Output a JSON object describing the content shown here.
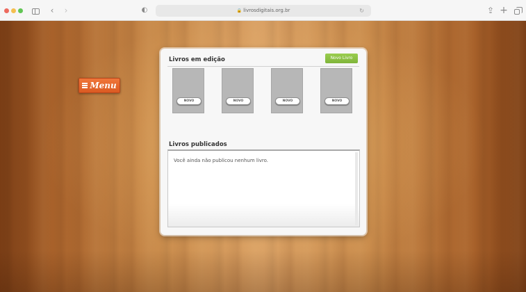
{
  "browser": {
    "url": "livrosdigitais.org.br"
  },
  "menu": {
    "label": "Menu"
  },
  "editing": {
    "title": "Livros em edição",
    "new_book_label": "Novo Livro",
    "books": [
      {
        "label": "NOVO"
      },
      {
        "label": "NOVO"
      },
      {
        "label": "NOVO"
      },
      {
        "label": "NOVO"
      }
    ]
  },
  "published": {
    "title": "Livros publicados",
    "empty_message": "Você ainda não publicou nenhum livro."
  },
  "colors": {
    "menu_orange": "#e4622a",
    "new_book_green": "#8bc34a",
    "book_placeholder": "#b7b7b7"
  }
}
